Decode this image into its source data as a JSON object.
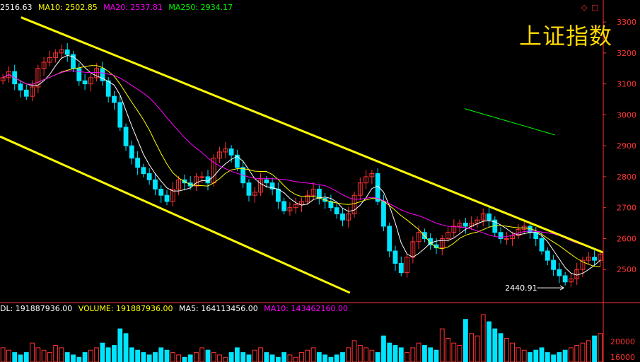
{
  "title": "上证指数",
  "colors": {
    "background": "#000000",
    "up": "#ff3333",
    "down": "#00e5ff",
    "ma5": "#ffffff",
    "ma10": "#ffff00",
    "ma20": "#ff00ff",
    "ma250": "#00ff00",
    "channel": "#ffff00",
    "axis": "#ff3333",
    "volume_label": "#ffff00"
  },
  "price_legend": {
    "ma5": "2516.63",
    "ma10": "MA10: 2502.85",
    "ma20": "MA20: 2537.81",
    "ma250": "MA250: 2934.17"
  },
  "volume_legend": {
    "vol": "DL: 191887936.00",
    "volume": "VOLUME: 191887936.00",
    "ma5": "MA5: 164113456.00",
    "ma10": "MA10: 143462160.00"
  },
  "low_annotation": "2440.91",
  "icons": [
    "diamond-icon",
    "square-icon",
    "dots-icon"
  ],
  "chart_data": [
    {
      "type": "candlestick",
      "y_ticks": [
        "3300",
        "3200",
        "3100",
        "3000",
        "2900",
        "2800",
        "2700",
        "2600",
        "2500"
      ],
      "ylim": [
        2400,
        3330
      ],
      "grid": false,
      "series_names": [
        "MA5",
        "MA10",
        "MA20",
        "MA250"
      ],
      "annotations": [
        {
          "text": "2440.91",
          "type": "low-marker"
        }
      ],
      "trendlines": [
        {
          "name": "channel-upper",
          "from": [
            0.035,
            3315
          ],
          "to": [
            1.0,
            2555
          ]
        },
        {
          "name": "channel-lower",
          "from": [
            0.0,
            2930
          ],
          "to": [
            0.58,
            2425
          ]
        },
        {
          "name": "ma250-segment",
          "from": [
            0.77,
            3020
          ],
          "to": [
            0.92,
            2935
          ]
        }
      ],
      "closes": [
        3120,
        3140,
        3100,
        3080,
        3060,
        3090,
        3150,
        3170,
        3185,
        3200,
        3210,
        3195,
        3150,
        3110,
        3100,
        3120,
        3150,
        3110,
        3060,
        3040,
        2960,
        2900,
        2860,
        2830,
        2810,
        2790,
        2760,
        2740,
        2720,
        2760,
        2790,
        2780,
        2770,
        2800,
        2800,
        2780,
        2860,
        2880,
        2890,
        2870,
        2830,
        2780,
        2740,
        2750,
        2790,
        2780,
        2760,
        2720,
        2690,
        2700,
        2710,
        2720,
        2740,
        2760,
        2730,
        2720,
        2700,
        2680,
        2660,
        2680,
        2740,
        2780,
        2800,
        2810,
        2720,
        2640,
        2560,
        2520,
        2490,
        2540,
        2590,
        2620,
        2600,
        2580,
        2570,
        2600,
        2620,
        2640,
        2650,
        2640,
        2650,
        2660,
        2680,
        2660,
        2620,
        2600,
        2600,
        2610,
        2630,
        2640,
        2620,
        2600,
        2560,
        2530,
        2500,
        2480,
        2460,
        2470,
        2500,
        2530,
        2540,
        2530,
        2550
      ],
      "volumes": [
        0.3,
        0.25,
        0.2,
        0.15,
        0.2,
        0.4,
        0.3,
        0.25,
        0.2,
        0.35,
        0.3,
        0.2,
        0.15,
        0.1,
        0.2,
        0.25,
        0.3,
        0.4,
        0.3,
        0.35,
        0.7,
        0.6,
        0.3,
        0.25,
        0.2,
        0.15,
        0.2,
        0.3,
        0.25,
        0.2,
        0.15,
        0.1,
        0.15,
        0.2,
        0.3,
        0.25,
        0.2,
        0.15,
        0.1,
        0.2,
        0.3,
        0.2,
        0.15,
        0.25,
        0.3,
        0.2,
        0.15,
        0.1,
        0.2,
        0.15,
        0.1,
        0.2,
        0.25,
        0.3,
        0.2,
        0.15,
        0.1,
        0.15,
        0.2,
        0.3,
        0.45,
        0.35,
        0.3,
        0.25,
        0.2,
        0.55,
        0.4,
        0.35,
        0.3,
        0.2,
        0.3,
        0.4,
        0.35,
        0.3,
        0.25,
        0.7,
        0.5,
        0.4,
        0.35,
        0.9,
        0.6,
        0.55,
        1.0,
        0.85,
        0.7,
        0.6,
        0.5,
        0.4,
        0.3,
        0.25,
        0.2,
        0.25,
        0.3,
        0.2,
        0.15,
        0.2,
        0.25,
        0.3,
        0.35,
        0.4,
        0.45,
        0.55,
        0.6
      ],
      "volume_ticks": [
        "20000",
        "16000"
      ]
    }
  ]
}
